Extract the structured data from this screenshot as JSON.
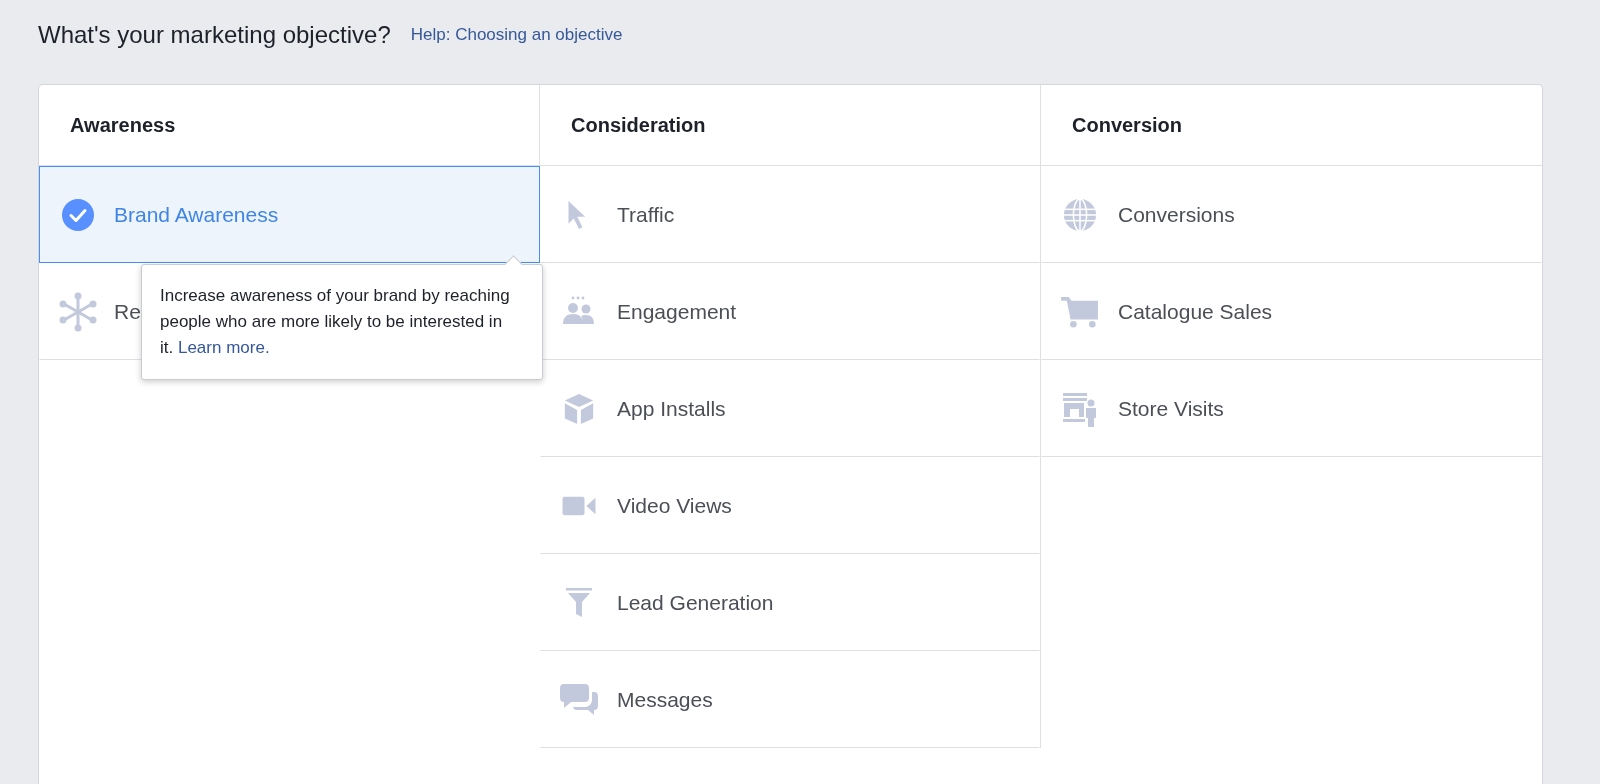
{
  "heading": {
    "title": "What's your marketing objective?",
    "help_link": "Help: Choosing an objective"
  },
  "columns": [
    {
      "title": "Awareness",
      "items": [
        {
          "label": "Brand Awareness",
          "selected": true
        },
        {
          "label": "Re",
          "selected": false
        }
      ]
    },
    {
      "title": "Consideration",
      "items": [
        {
          "label": "Traffic",
          "selected": false
        },
        {
          "label": "Engagement",
          "selected": false
        },
        {
          "label": "App Installs",
          "selected": false
        },
        {
          "label": "Video Views",
          "selected": false
        },
        {
          "label": "Lead Generation",
          "selected": false
        },
        {
          "label": "Messages",
          "selected": false
        }
      ]
    },
    {
      "title": "Conversion",
      "items": [
        {
          "label": "Conversions",
          "selected": false
        },
        {
          "label": "Catalogue Sales",
          "selected": false
        },
        {
          "label": "Store Visits",
          "selected": false
        }
      ]
    }
  ],
  "tooltip": {
    "text": "Increase awareness of your brand by reaching people who are more likely to be interested in it.",
    "link": "Learn more."
  }
}
